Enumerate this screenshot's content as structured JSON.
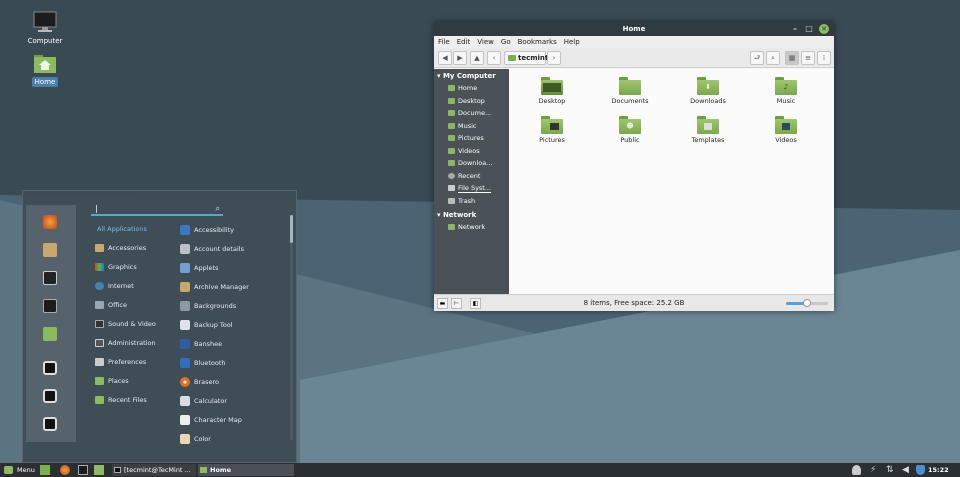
{
  "desktop": {
    "icons": [
      {
        "label": "Computer",
        "icon": "computer-icon"
      },
      {
        "label": "Home",
        "icon": "home-folder-icon"
      }
    ]
  },
  "window": {
    "title": "Home",
    "menu": [
      "File",
      "Edit",
      "View",
      "Go",
      "Bookmarks",
      "Help"
    ],
    "path": "tecmint",
    "sidebar": {
      "section1": "My Computer",
      "items": [
        "Home",
        "Desktop",
        "Docume...",
        "Music",
        "Pictures",
        "Videos",
        "Downloa...",
        "Recent",
        "File Syst...",
        "Trash"
      ],
      "section2": "Network",
      "network_items": [
        "Network"
      ]
    },
    "folders": [
      "Desktop",
      "Documents",
      "Downloads",
      "Music",
      "Pictures",
      "Public",
      "Templates",
      "Videos"
    ],
    "status": "8 items, Free space: 25.2 GB",
    "zoom_level": 0.5
  },
  "menu": {
    "search_placeholder": "|",
    "categories": [
      "All Applications",
      "Accessories",
      "Graphics",
      "Internet",
      "Office",
      "Sound & Video",
      "Administration",
      "Preferences",
      "Places",
      "Recent Files"
    ],
    "apps": [
      "Accessibility",
      "Account details",
      "Applets",
      "Archive Manager",
      "Backgrounds",
      "Backup Tool",
      "Banshee",
      "Bluetooth",
      "Brasero",
      "Calculator",
      "Character Map",
      "Color"
    ]
  },
  "panel": {
    "menu_label": "Menu",
    "tasks": [
      "[tecmint@TecMint ...",
      "Home"
    ],
    "clock": "15:22"
  },
  "colors": {
    "accent": "#8fbc5a",
    "selection": "#5aa8c8"
  }
}
